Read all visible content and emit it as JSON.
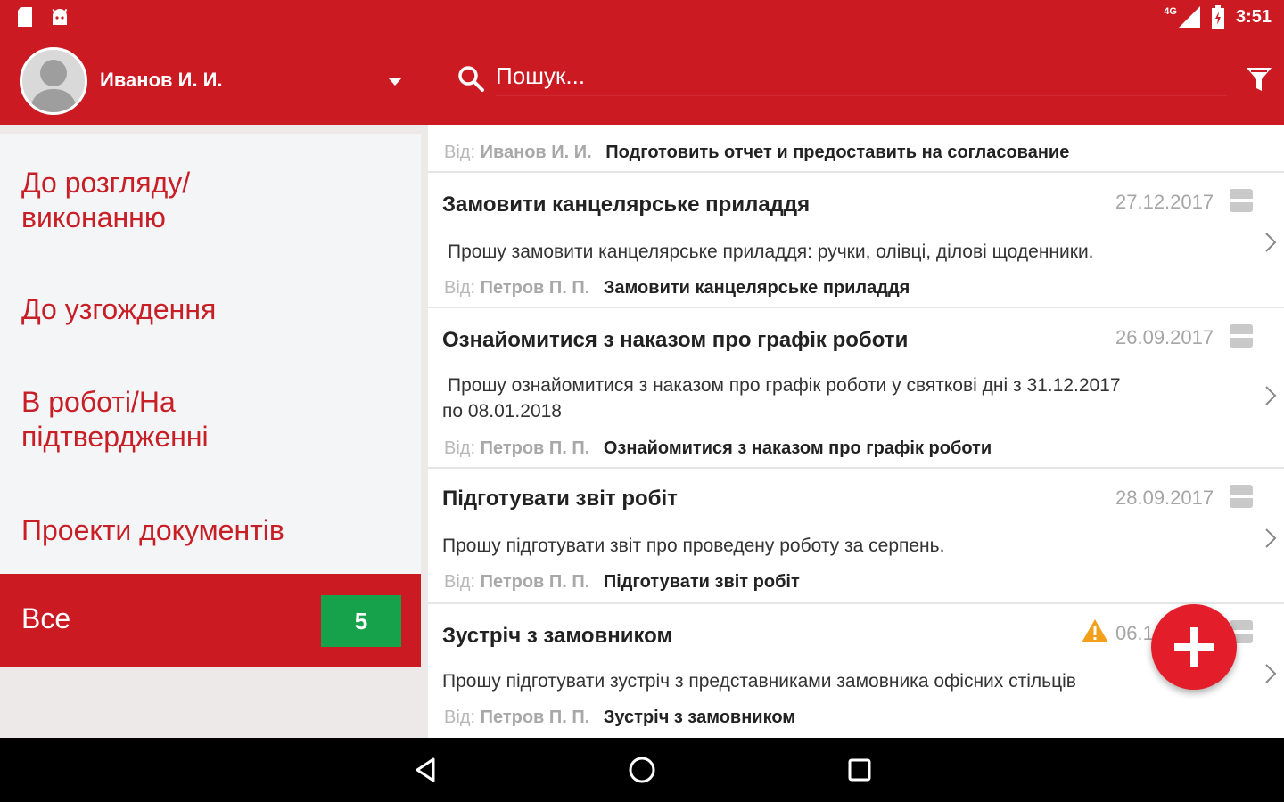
{
  "status_bar": {
    "time": "3:51",
    "network": "4G",
    "icons": [
      "sd-card-icon",
      "android-icon",
      "signal-icon",
      "battery-icon"
    ]
  },
  "header": {
    "user_name": "Иванов И. И.",
    "search_placeholder": "Пошук...",
    "icons": [
      "avatar-icon",
      "dropdown-arrow-icon",
      "search-icon",
      "filter-icon"
    ]
  },
  "sidebar": {
    "items": [
      {
        "label_line1": "До розгляду/",
        "label_line2": "виконанню"
      },
      {
        "label_line1": "До узгождення"
      },
      {
        "label_line1": "В роботі/На",
        "label_line2": "підтвердженні"
      },
      {
        "label_line1": "Проекти документів"
      }
    ],
    "active": {
      "label": "Все",
      "count": "5"
    }
  },
  "tasks": [
    {
      "from_prefix": "Від:",
      "from_name": "Иванов И. И.",
      "subject": "Подготовить отчет и предоставить на согласование"
    },
    {
      "title": "Замовити канцелярське приладдя",
      "date": "27.12.2017",
      "body": "Прошу замовити канцелярське приладдя: ручки, олівці, ділові щоденники.",
      "from_prefix": "Від:",
      "from_name": "Петров П. П.",
      "subject": "Замовити канцелярське приладдя"
    },
    {
      "title": "Ознайомитися з наказом про графік роботи",
      "date": "26.09.2017",
      "body_line1": "Прошу ознайомитися з наказом про графік роботи у святкові дні з 31.12.2017",
      "body_line2": "по 08.01.2018",
      "from_prefix": "Від:",
      "from_name": "Петров П. П.",
      "subject": "Ознайомитися з наказом про графік роботи"
    },
    {
      "title": "Підготувати звіт робіт",
      "date": "28.09.2017",
      "body": "Прошу підготувати звіт про проведену роботу за серпень.",
      "from_prefix": "Від:",
      "from_name": "Петров П. П.",
      "subject": "Підготувати звіт робіт"
    },
    {
      "title": "Зустріч з замовником",
      "date": "06.1",
      "body": "Прошу підготувати зустріч з представниками замовника офісних стільців",
      "from_prefix": "Від:",
      "from_name": "Петров П. П.",
      "subject": "Зустріч з замовником"
    }
  ],
  "colors": {
    "accent": "#cc1a23",
    "badge": "#16a24a",
    "fab": "#e31e2a",
    "warning": "#f2a01c"
  },
  "nav_bar": {
    "icons": [
      "back-icon",
      "home-icon",
      "recents-icon"
    ]
  }
}
